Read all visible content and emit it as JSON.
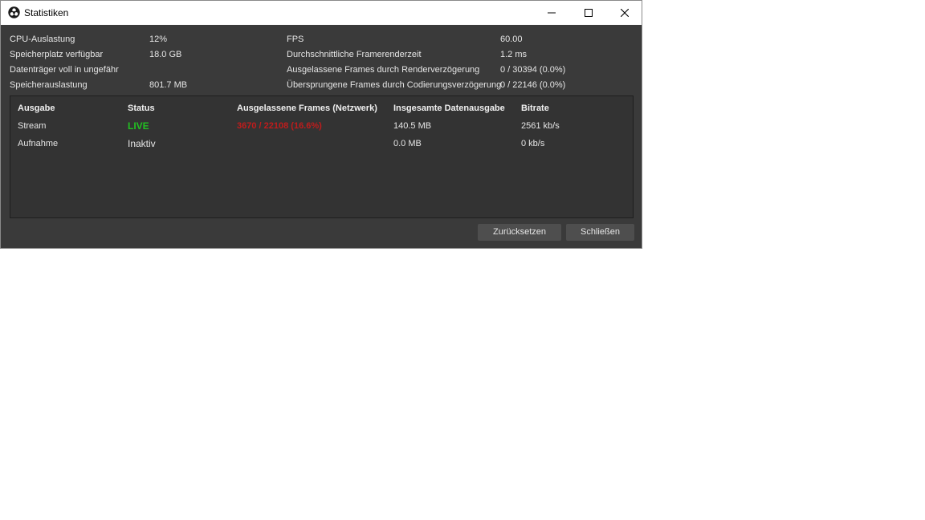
{
  "window": {
    "title": "Statistiken",
    "app_icon": "obs-logo-icon"
  },
  "stats_left": [
    {
      "label": "CPU-Auslastung",
      "value": "12%"
    },
    {
      "label": "Speicherplatz verfügbar",
      "value": "18.0 GB"
    },
    {
      "label": "Datenträger voll in ungefähr",
      "value": ""
    },
    {
      "label": "Speicherauslastung",
      "value": "801.7 MB"
    }
  ],
  "stats_right": [
    {
      "label": "FPS",
      "value": "60.00"
    },
    {
      "label": "Durchschnittliche Framerenderzeit",
      "value": "1.2 ms"
    },
    {
      "label": "Ausgelassene Frames durch Renderverzögerung",
      "value": "0 / 30394 (0.0%)"
    },
    {
      "label": "Übersprungene Frames durch Codierungsverzögerung",
      "value": "0 / 22146 (0.0%)"
    }
  ],
  "outputs": {
    "headers": [
      "Ausgabe",
      "Status",
      "Ausgelassene Frames (Netzwerk)",
      "Insgesamte Datenausgabe",
      "Bitrate"
    ],
    "rows": [
      {
        "name": "Stream",
        "status": "LIVE",
        "dropped": "3670 / 22108 (16.6%)",
        "total": "140.5 MB",
        "bitrate": "2561 kb/s"
      },
      {
        "name": "Aufnahme",
        "status": "Inaktiv",
        "dropped": "",
        "total": "0.0 MB",
        "bitrate": "0 kb/s"
      }
    ]
  },
  "buttons": {
    "reset": "Zurücksetzen",
    "close": "Schließen"
  },
  "colors": {
    "live": "#22c022",
    "dropped": "#c01c1c",
    "background": "#3a3a3a"
  }
}
